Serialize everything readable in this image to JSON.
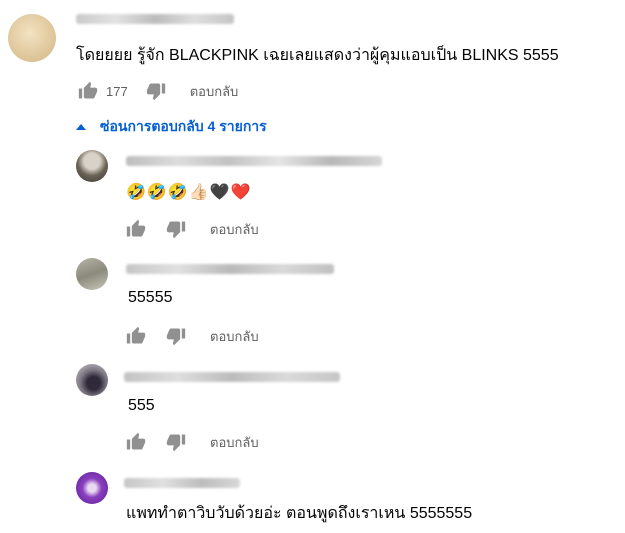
{
  "comments": [
    {
      "text": "โดยยยย รู้จัก BLACKPINK เฉยเลยแสดงว่าผู้คุมแอบเป็น BLINKS  5555",
      "likes": "177",
      "reply_label": "ตอบกลับ"
    },
    {
      "text": "🤣🤣🤣👍🏻🖤❤️",
      "reply_label": "ตอบกลับ"
    },
    {
      "text": "55555",
      "reply_label": "ตอบกลับ"
    },
    {
      "text": "555",
      "reply_label": "ตอบกลับ"
    },
    {
      "text": "แพททำตาวิบวับด้วยอ่ะ ตอนพูดถึงเราเหน 5555555"
    }
  ],
  "replies_toggle": {
    "label": "ซ่อนการตอบกลับ 4 รายการ"
  },
  "colors": {
    "link_blue": "#065fd4",
    "secondary_text": "#606060",
    "icon_gray": "#909090"
  }
}
